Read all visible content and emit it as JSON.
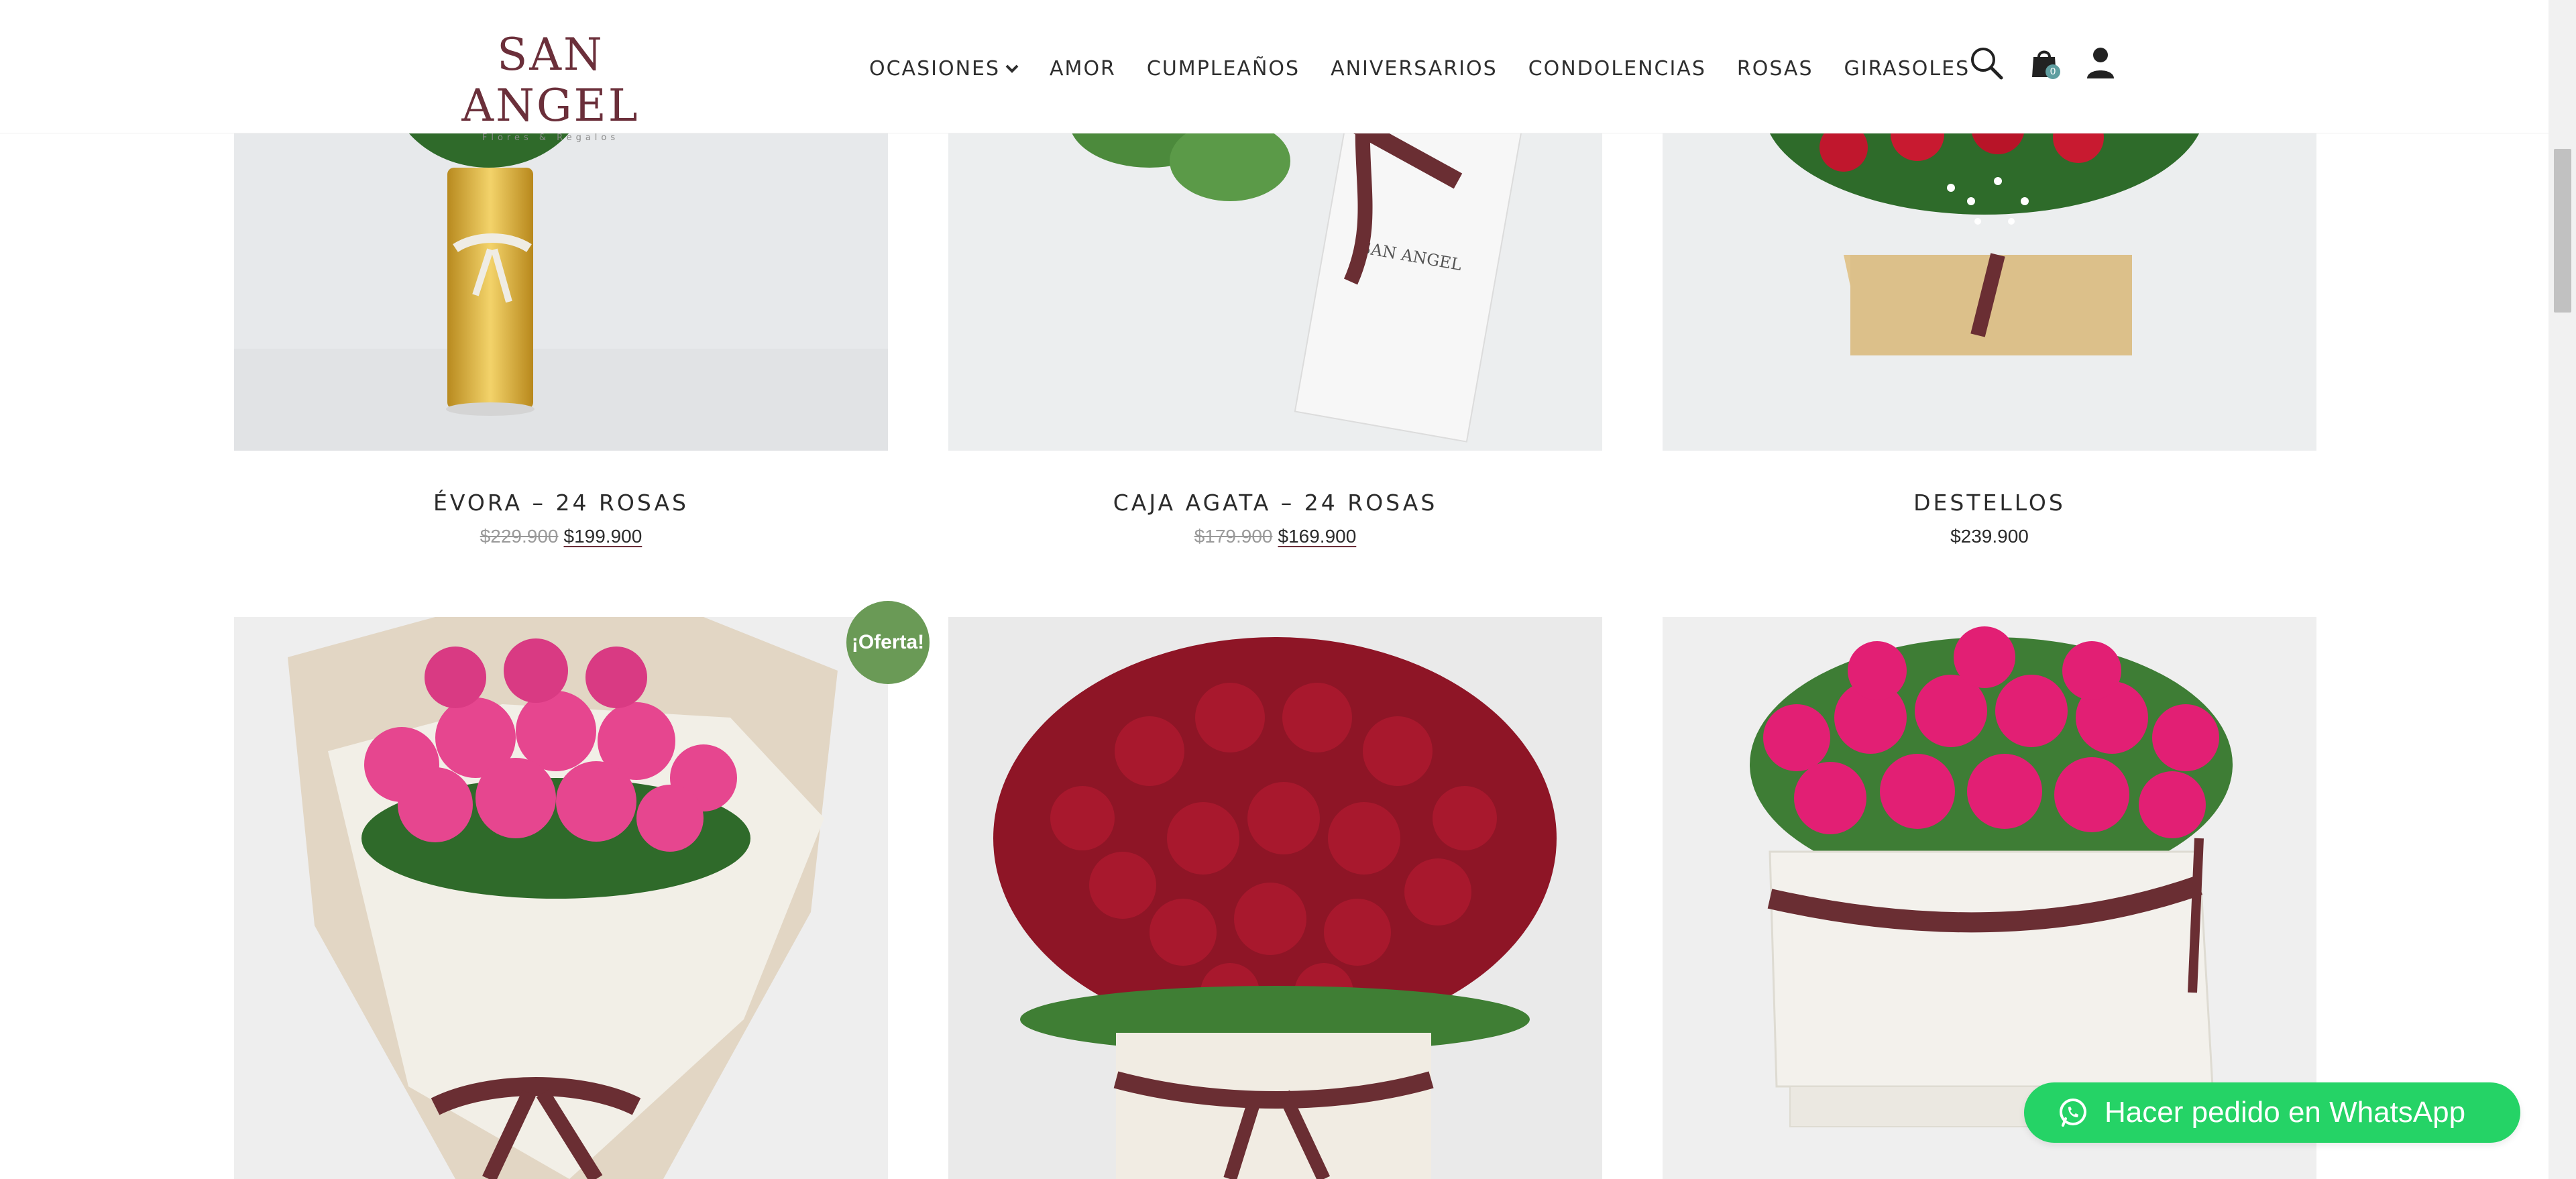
{
  "brand": {
    "name": "SAN ANGEL",
    "tagline": "Flores & Regalos"
  },
  "colors": {
    "brand": "#6b2f3a",
    "sale_badge": "#6a9a56",
    "whatsapp": "#25d366",
    "cart_badge": "#5f9ea0"
  },
  "nav": {
    "items": [
      {
        "label": "OCASIONES",
        "has_dropdown": true
      },
      {
        "label": "AMOR"
      },
      {
        "label": "CUMPLEAÑOS"
      },
      {
        "label": "ANIVERSARIOS"
      },
      {
        "label": "CONDOLENCIAS"
      },
      {
        "label": "ROSAS"
      },
      {
        "label": "GIRASOLES"
      }
    ],
    "icons": [
      "search-icon",
      "cart-icon",
      "user-icon"
    ],
    "cart_count": "0"
  },
  "products": [
    {
      "title": "ÉVORA – 24 ROSAS",
      "price_old": "$229.900",
      "price_new": "$199.900"
    },
    {
      "title": "CAJA AGATA – 24 ROSAS",
      "price_old": "$179.900",
      "price_new": "$169.900"
    },
    {
      "title": "DESTELLOS",
      "price": "$239.900"
    }
  ],
  "sale_badge": "¡Oferta!",
  "whatsapp": {
    "label": "Hacer pedido en WhatsApp",
    "icon": "whatsapp-icon"
  }
}
